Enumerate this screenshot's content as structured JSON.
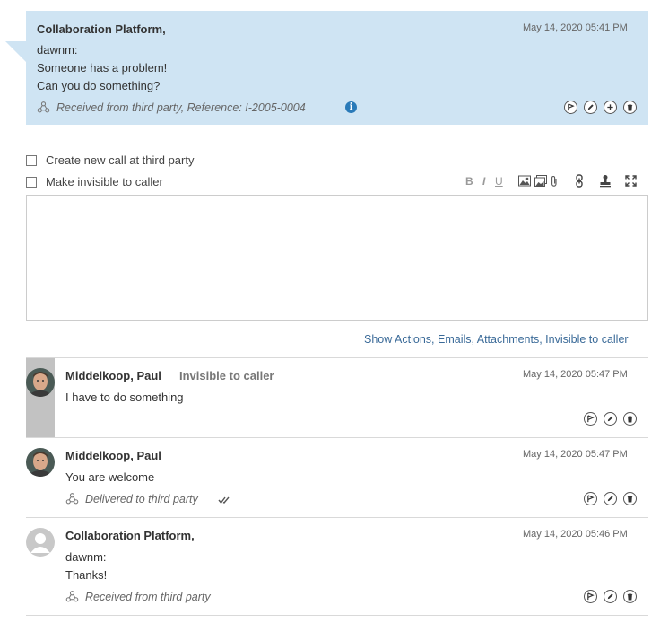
{
  "incoming": {
    "sender": "Collaboration Platform,",
    "date": "May 14, 2020 05:41 PM",
    "body": "dawnm:\nSomeone has a problem!\nCan you do something?",
    "meta": "Received from third party, Reference: I-2005-0004"
  },
  "compose": {
    "create_call_label": "Create new call at third party",
    "invisible_label": "Make invisible to caller",
    "toolbar": {
      "bold": "B",
      "italic": "I",
      "underline": "U"
    },
    "text": ""
  },
  "filter_link": "Show Actions, Emails, Attachments, Invisible to caller",
  "messages": [
    {
      "sender": "Middelkoop, Paul",
      "tag": "Invisible to caller",
      "date": "May 14, 2020 05:47 PM",
      "body": "I have to do something"
    },
    {
      "sender": "Middelkoop, Paul",
      "date": "May 14, 2020 05:47 PM",
      "body": "You are welcome",
      "meta": "Delivered to third party"
    },
    {
      "sender": "Collaboration Platform,",
      "date": "May 14, 2020 05:46 PM",
      "body": "dawnm:\nThanks!",
      "meta": "Received from third party"
    }
  ],
  "colors": {
    "incoming_bg": "#cfe4f3",
    "invisible_bar": "#c2c2c2",
    "link": "#3a6a98",
    "info_icon": "#2a7ab8"
  }
}
